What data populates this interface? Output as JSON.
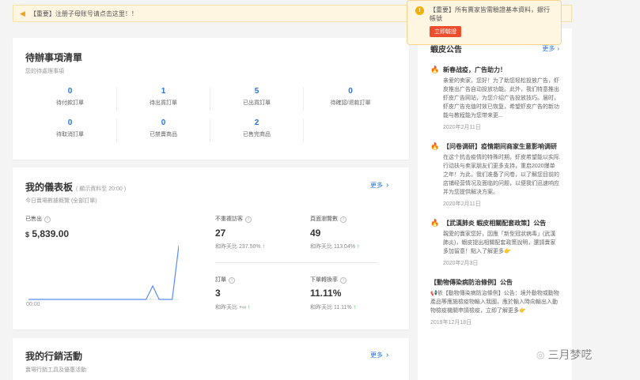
{
  "banner": {
    "text": "【重要】注册子母账号请点击这里！！"
  },
  "todo": {
    "title": "待辦事項清單",
    "subtitle": "您的待處理事項",
    "items": [
      {
        "value": "0",
        "label": "待付款訂單"
      },
      {
        "value": "1",
        "label": "待出貨訂單"
      },
      {
        "value": "5",
        "label": "已出貨訂單"
      },
      {
        "value": "0",
        "label": "待確認/退款訂單"
      },
      {
        "value": "0",
        "label": "待取消訂單"
      },
      {
        "value": "0",
        "label": "已禁賣商品"
      },
      {
        "value": "2",
        "label": "已售完商品"
      }
    ]
  },
  "dashboard": {
    "title": "我的儀表板",
    "title_note": "( 顯示資料至 20:00 )",
    "subtitle": "今日賣場數據概覽 (全部訂單)",
    "more": "更多",
    "sales_label": "已售出",
    "sales_currency": "$",
    "sales_value": "5,839.00",
    "chart_x_label": "00:00",
    "visitors_label": "不重複訪客",
    "visitors_value": "27",
    "visitors_compare": "和昨天比 237.50%",
    "pageviews_label": "頁面瀏覽數",
    "pageviews_value": "49",
    "pageviews_compare": "和昨天比 113.04%",
    "orders_label": "訂單",
    "orders_value": "3",
    "orders_compare": "和昨天比 +∞",
    "conversion_label": "下單轉換率",
    "conversion_value": "11.11%",
    "conversion_compare": "和昨天比 11.11%"
  },
  "marketing": {
    "title": "我的行銷活動",
    "subtitle": "賣場行銷工具及優惠活動",
    "more": "更多"
  },
  "announcements": {
    "title": "蝦皮公告",
    "more": "更多",
    "items": [
      {
        "title": "新春战疫，广告助力！",
        "body": "亲爱的卖家，您好！为了助您轻松投放广告，虾皮推出广告自动投放功能。此外，我们特意推出虾皮广告网站，为您介绍广告投放技巧。届时，虾皮广告充值时效已恢复，希望虾皮广告的新功能与教程能为您带来更...",
        "date": "2020年2月11日"
      },
      {
        "title": "【问卷调研】疫情期间商家生意影响调研",
        "body": "在这个抗击疫情的特殊时期，虾皮希望能以实际行动扶与卖家朋友们更多支持，重启2020爆单之年！为此，我们准备了问卷，以了解您目前的店铺经营情况及面临的问题，以便我们迅速响应并为您提供解决方案。",
        "date": "2020年2月11日"
      },
      {
        "title": "【武漢肺炎 蝦皮相關配套政策】公告",
        "body": "親愛的賣家您好，因應「新型冠狀病毒」(武漢肺炎)，蝦皮提出相關配套政策說明，還請賣家多加留意！點入了解更多👉",
        "date": "2020年2月3日"
      },
      {
        "title": "【動物傳染病防治條例】公告",
        "body": "📢依【動物傳染病防治條例】公告：境外動物或動物產品等應施檢疫物輸入我國，應於輸入時向輸出入動物檢疫機關申請檢疫，立即了解更多👉",
        "date": "2019年12月18日"
      }
    ]
  },
  "popup": {
    "text": "【重要】所有賣家皆需驗證基本資料，銀行帳號",
    "button": "立即驗證"
  },
  "watermark": {
    "text": "三月梦呓"
  },
  "chart_data": {
    "type": "line",
    "x": [
      "00:00"
    ],
    "series": [
      {
        "values": [
          0,
          0,
          0,
          0,
          0,
          0,
          0,
          0,
          0,
          0,
          0,
          0,
          0,
          0,
          0,
          0,
          0,
          0,
          0,
          1,
          0,
          0,
          0,
          4
        ]
      }
    ],
    "color": "#5b8def"
  },
  "colors": {
    "accent": "#2673dd",
    "brand": "#ee4d2d",
    "positive": "#2fb344"
  }
}
